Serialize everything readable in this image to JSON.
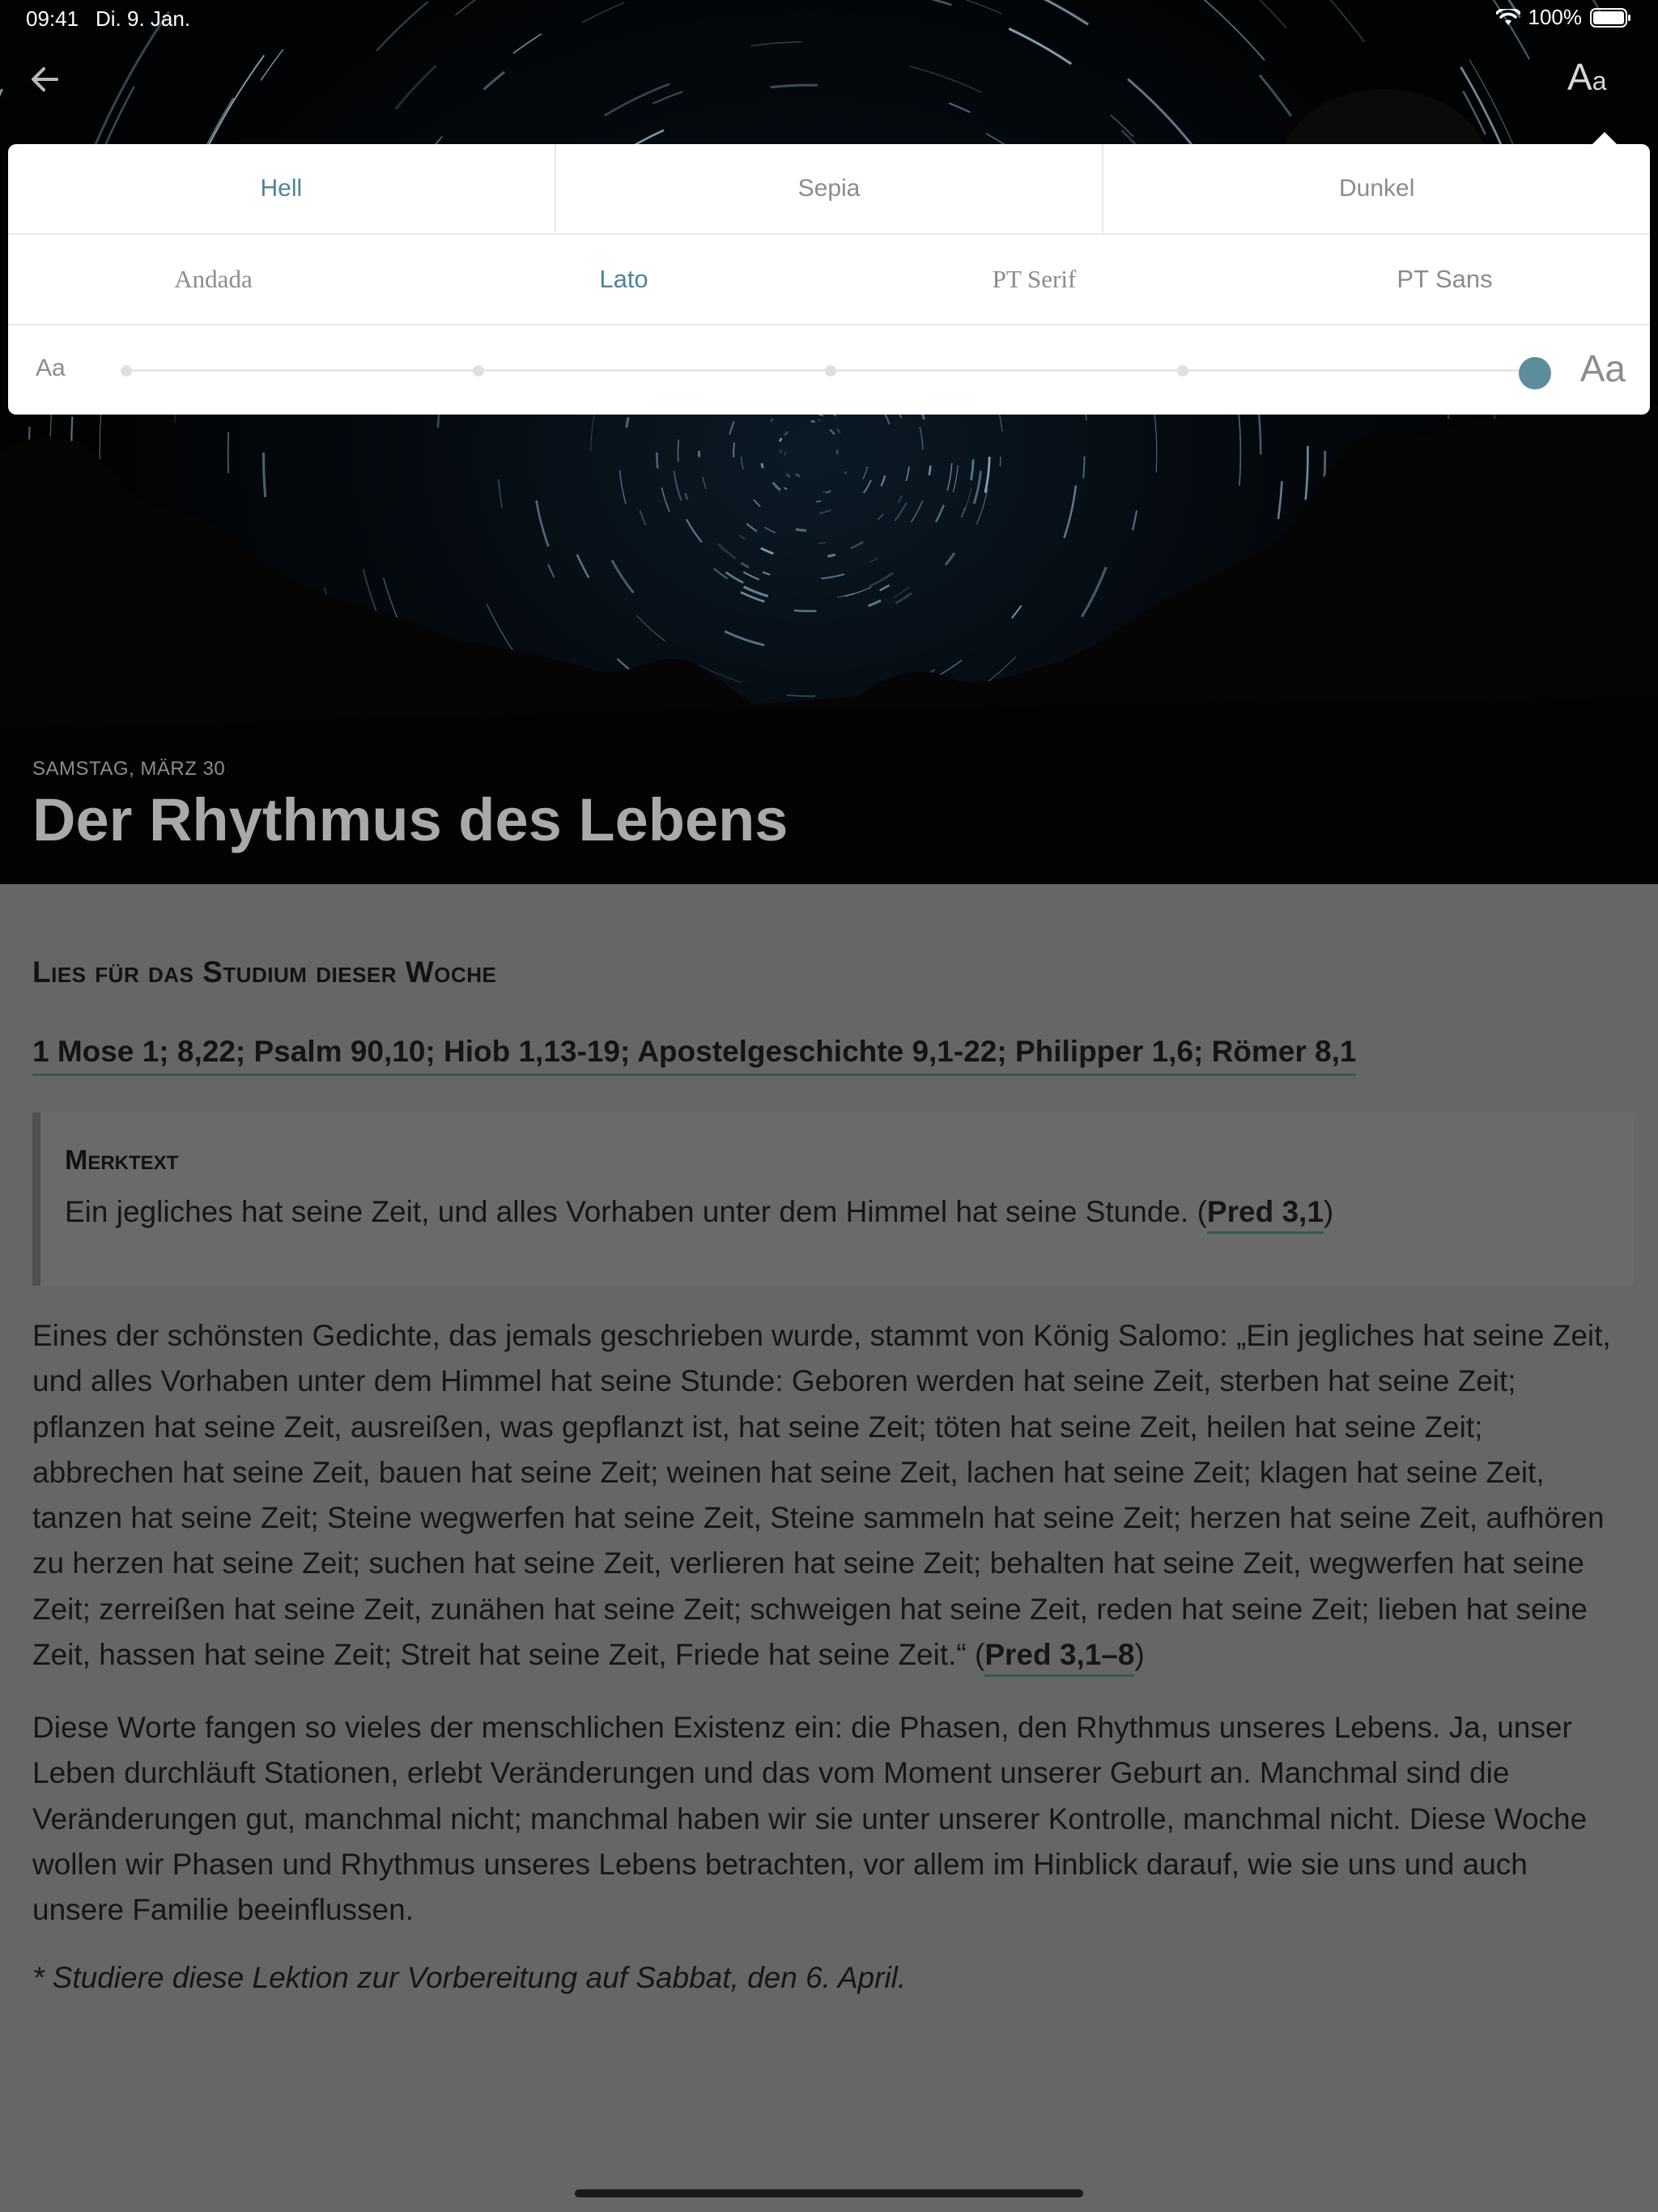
{
  "status_bar": {
    "time": "09:41",
    "date": "Di. 9. Jan.",
    "battery": "100%"
  },
  "header": {
    "back_icon": "arrow-left-icon",
    "font_settings_icon": "text-size-icon",
    "font_settings_big": "A",
    "font_settings_small": "a"
  },
  "popover": {
    "themes": [
      {
        "label": "Hell",
        "active": true
      },
      {
        "label": "Sepia",
        "active": false
      },
      {
        "label": "Dunkel",
        "active": false
      }
    ],
    "fonts": [
      {
        "label": "Andada",
        "active": false
      },
      {
        "label": "Lato",
        "active": true
      },
      {
        "label": "PT Serif",
        "active": false
      },
      {
        "label": "PT Sans",
        "active": false
      }
    ],
    "size_small_label": "Aa",
    "size_large_label": "Aa",
    "size_steps": 5,
    "size_selected_step": 5,
    "accent_color": "#5b8d9c"
  },
  "hero": {
    "date": "SAMSTAG, MÄRZ 30",
    "title": "Der Rhythmus des Lebens"
  },
  "lesson": {
    "reading_heading": "Lies für das Studium dieser Woche",
    "readings": "1 Mose 1; 8,22; Psalm 90,10; Hiob 1,13-19; Apostelgeschichte 9,1-22; Philipper 1,6; Römer 8,1",
    "memory_title": "Merktext",
    "memory_text": "Ein jegliches hat seine Zeit, und alles Vorhaben unter dem Himmel hat seine Stunde. (",
    "memory_ref": "Pred 3,1",
    "memory_close": ")",
    "para1_text": "Eines der schönsten Gedichte, das jemals geschrieben wurde, stammt von König Salomo: „Ein jegliches hat seine Zeit, und alles Vorhaben unter dem Himmel hat seine Stunde: Geboren werden hat seine Zeit, sterben hat seine Zeit; pflanzen hat seine Zeit, ausreißen, was gepflanzt ist, hat seine Zeit; töten hat seine Zeit, heilen hat seine Zeit; abbrechen hat seine Zeit, bauen hat seine Zeit; weinen hat seine Zeit, lachen hat seine Zeit; klagen hat seine Zeit, tanzen hat seine Zeit; Steine wegwerfen hat seine Zeit, Steine sammeln hat seine Zeit; herzen hat seine Zeit, aufhören zu herzen hat seine Zeit; suchen hat seine Zeit, verlieren hat seine Zeit; behalten hat seine Zeit, wegwerfen hat seine Zeit; zerreißen hat seine Zeit, zunähen hat seine Zeit; schweigen hat seine Zeit, reden hat seine Zeit; lieben hat seine Zeit, hassen hat seine Zeit; Streit hat seine Zeit, Friede hat seine Zeit.“ (",
    "para1_ref": "Pred 3,1–8",
    "para1_close": ")",
    "para2": "Diese Worte fangen so vieles der menschlichen Existenz ein: die Phasen, den Rhythmus unseres Lebens. Ja, unser Leben durchläuft Stationen, erlebt Veränderungen und das vom Moment unserer Geburt an. Manchmal sind die Veränderungen gut, manchmal nicht; manchmal haben wir sie unter unserer Kontrolle, manchmal nicht. Diese Woche wollen wir Phasen und Rhythmus unseres Lebens betrachten, vor allem im Hinblick darauf, wie sie uns und auch unsere Familie beeinflussen.",
    "footnote": "* Studiere diese Lektion zur Vorbereitung auf Sabbat, den 6. April."
  }
}
